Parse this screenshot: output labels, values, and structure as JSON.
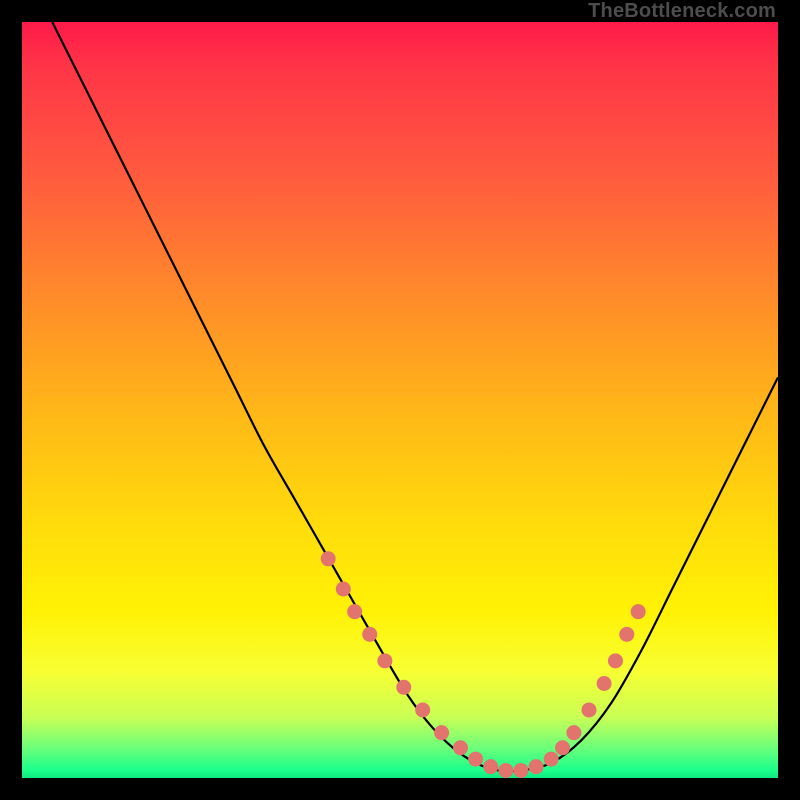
{
  "watermark": "TheBottleneck.com",
  "colors": {
    "curve_stroke": "#000000",
    "marker_fill": "#e2736d",
    "marker_stroke": "#d85a55",
    "gradient_top": "#ff1a4a",
    "gradient_bottom": "#10e87f"
  },
  "chart_data": {
    "type": "line",
    "title": "",
    "xlabel": "",
    "ylabel": "",
    "xlim": [
      0,
      100
    ],
    "ylim": [
      0,
      100
    ],
    "series": [
      {
        "name": "bottleneck-curve",
        "x": [
          4,
          8,
          12,
          16,
          20,
          24,
          28,
          32,
          36,
          40,
          44,
          48,
          51,
          54,
          57,
          60,
          63,
          66,
          70,
          74,
          78,
          82,
          86,
          90,
          94,
          98,
          100
        ],
        "y": [
          100,
          92,
          84,
          76,
          68,
          60,
          52,
          44,
          37,
          30,
          23,
          16,
          11,
          7,
          4,
          2,
          1,
          1,
          2,
          5,
          10,
          17,
          25,
          33,
          41,
          49,
          53
        ]
      }
    ],
    "markers": {
      "name": "highlighted-points",
      "x": [
        40.5,
        42.5,
        44,
        46,
        48,
        50.5,
        53,
        55.5,
        58,
        60,
        62,
        64,
        66,
        68,
        70,
        71.5,
        73,
        75,
        77,
        78.5,
        80,
        81.5
      ],
      "y": [
        29,
        25,
        22,
        19,
        15.5,
        12,
        9,
        6,
        4,
        2.5,
        1.5,
        1,
        1,
        1.5,
        2.5,
        4,
        6,
        9,
        12.5,
        15.5,
        19,
        22
      ]
    }
  }
}
